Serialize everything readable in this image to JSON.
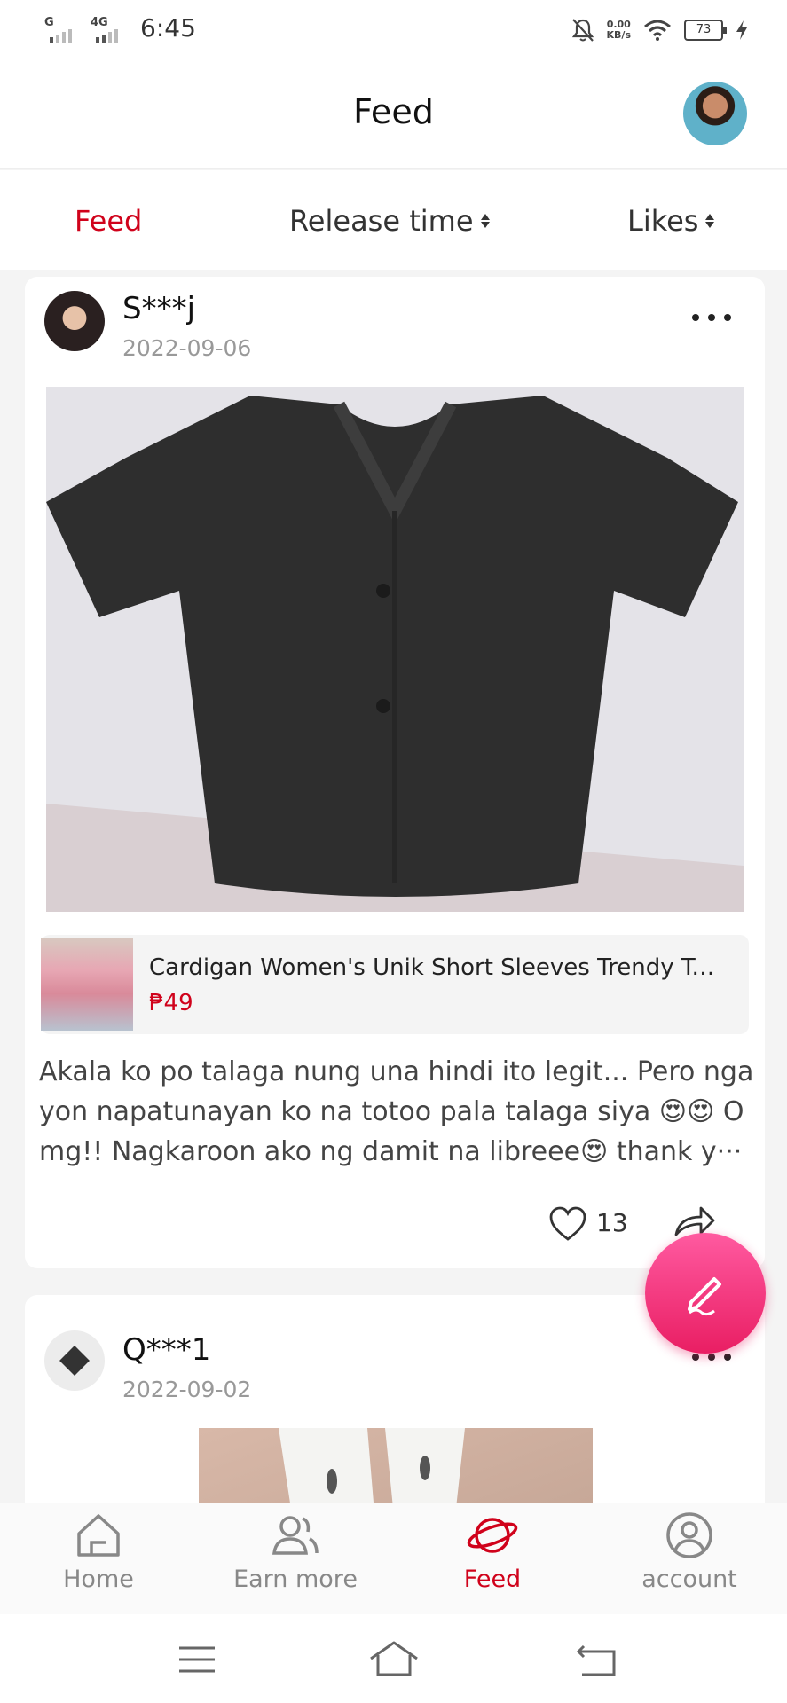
{
  "status": {
    "net1": "G",
    "net2": "4G",
    "time": "6:45",
    "speed_value": "0.00",
    "speed_unit": "KB/s",
    "battery": "73"
  },
  "header": {
    "title": "Feed"
  },
  "sort": {
    "feed": "Feed",
    "release_time": "Release time",
    "likes": "Likes"
  },
  "posts": [
    {
      "user": "S***j",
      "date": "2022-09-06",
      "product_title": "Cardigan Women's Unik Short Sleeves Trendy To···",
      "product_price": "₱49",
      "text": "Akala ko po talaga nung una hindi ito legit... Pero nga yon napatunayan ko na totoo pala talaga siya 😍😍 O mg!! Nagkaroon ako ng damit na libreee😍 thank y···",
      "likes": "13"
    },
    {
      "user": "Q***1",
      "date": "2022-09-02"
    }
  ],
  "tabs": [
    {
      "label": "Home",
      "icon": "home-icon"
    },
    {
      "label": "Earn more",
      "icon": "users-icon"
    },
    {
      "label": "Feed",
      "icon": "planet-icon"
    },
    {
      "label": "account",
      "icon": "account-icon"
    }
  ],
  "colors": {
    "accent": "#d0021b",
    "fab": "#e91e63"
  }
}
